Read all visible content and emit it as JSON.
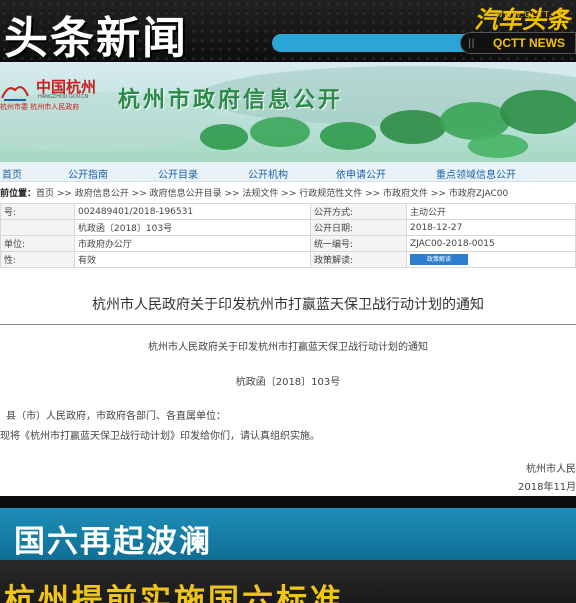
{
  "banner": {
    "title": "头条新闻",
    "logo_text": "汽车头条",
    "logo_url": "WWW.QCTT.CN",
    "channel": "QCTT NEWS",
    "channel_icon": "bars-icon"
  },
  "site": {
    "gov_name": "中国杭州",
    "gov_domain": "HANGZHOU.GOV.CN",
    "gov_sub": "杭州市委 杭州市人民政府",
    "title": "杭州市政府信息公开",
    "nav": [
      "首页",
      "公开指南",
      "公开目录",
      "公开机构",
      "依申请公开",
      "重点领域信息公开"
    ],
    "breadcrumb_label": "前位置：",
    "breadcrumb": "首页 >> 政府信息公开 >> 政府信息公开目录 >> 法规文件 >> 行政规范性文件 >> 市政府文件 >> 市政府ZJAC00"
  },
  "meta": {
    "rows": [
      {
        "k": "号:",
        "v": "002489401/2018-196531",
        "k2": "公开方式:",
        "v2": "主动公开"
      },
      {
        "k": "",
        "v": "杭政函〔2018〕103号",
        "k2": "公开日期:",
        "v2": "2018-12-27"
      },
      {
        "k": "单位:",
        "v": "市政府办公厅",
        "k2": "统一编号:",
        "v2": "ZJAC00-2018-0015"
      },
      {
        "k": "性:",
        "v": "有效",
        "k2": "政策解读:",
        "v2": ""
      }
    ],
    "badge": "政策解读"
  },
  "doc": {
    "title": "杭州市人民政府关于印发杭州市打赢蓝天保卫战行动计划的通知",
    "body_title": "杭州市人民政府关于印发杭州市打赢蓝天保卫战行动计划的通知",
    "number": "杭政函〔2018〕103号",
    "para1": "县（市）人民政府，市政府各部门、各直属单位：",
    "para2": "现将《杭州市打赢蓝天保卫战行动计划》印发给你们，请认真组织实施。",
    "sign1": "杭州市人民",
    "sign2": "2018年11月2"
  },
  "captions": {
    "headline": "国六再起波澜",
    "subline": "杭州提前实施国六标准"
  }
}
